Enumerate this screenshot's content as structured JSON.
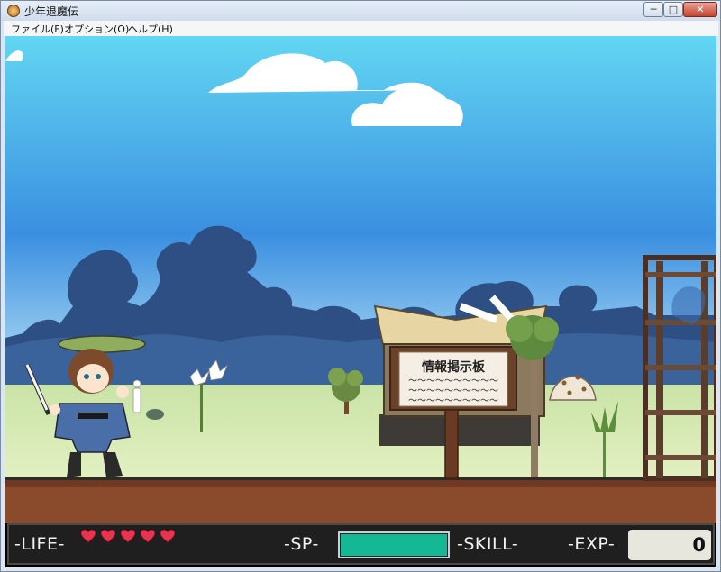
{
  "window": {
    "title": "少年退魔伝",
    "controls": {
      "minimize": "─",
      "maximize": "□",
      "close": "✕"
    }
  },
  "menu": {
    "file": "ファイル(F)",
    "option": "オプション(O)",
    "help": "ヘルプ(H)"
  },
  "scene": {
    "sign_title": "情報掲示板",
    "sign_lines": [
      "〜〜〜〜〜〜〜〜〜〜",
      "〜〜〜〜〜〜〜〜〜〜",
      "〜〜〜〜〜〜〜〜〜〜"
    ]
  },
  "hud": {
    "life_label": "-LIFE-",
    "life_hearts": 5,
    "sp_label": "-SP-",
    "sp_fraction": 1.0,
    "skill_label": "-SKILL-",
    "exp_label": "-EXP-",
    "exp_value": "0"
  },
  "colors": {
    "sky_top": "#62d6f2",
    "sky_bottom": "#bfe6f7",
    "grass": "#cfe69f",
    "dirt": "#8a4b2c",
    "sp_fill": "#14b895",
    "heart": "#e8344e"
  },
  "icons": [
    "app-icon",
    "heart-icon"
  ]
}
